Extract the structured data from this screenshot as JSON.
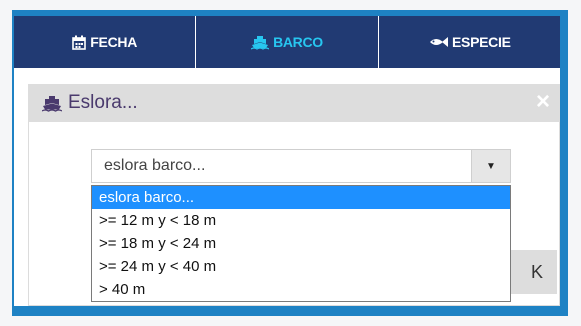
{
  "tabs": [
    {
      "label": "FECHA",
      "icon": "calendar-icon",
      "active": false
    },
    {
      "label": "BARCO",
      "icon": "ship-icon",
      "active": true
    },
    {
      "label": "ESPECIE",
      "icon": "fish-icon",
      "active": false
    }
  ],
  "header": {
    "title": "Eslora...",
    "icon": "ship-icon",
    "close": "×"
  },
  "select": {
    "value": "eslora barco...",
    "arrow": "▼"
  },
  "options": [
    {
      "label": "eslora barco...",
      "selected": true
    },
    {
      "label": ">= 12 m y < 18 m",
      "selected": false
    },
    {
      "label": ">= 18 m y < 24 m",
      "selected": false
    },
    {
      "label": ">= 24 m y < 40 m",
      "selected": false
    },
    {
      "label": "> 40 m",
      "selected": false
    }
  ],
  "behind_button": {
    "label": "K"
  },
  "colors": {
    "frame": "#1e82c4",
    "tab_bar": "#213a73",
    "tab_active_text": "#27c6f0",
    "header_bg": "#dddddd",
    "header_text": "#4a3a6d",
    "option_selected": "#1e90ff"
  }
}
